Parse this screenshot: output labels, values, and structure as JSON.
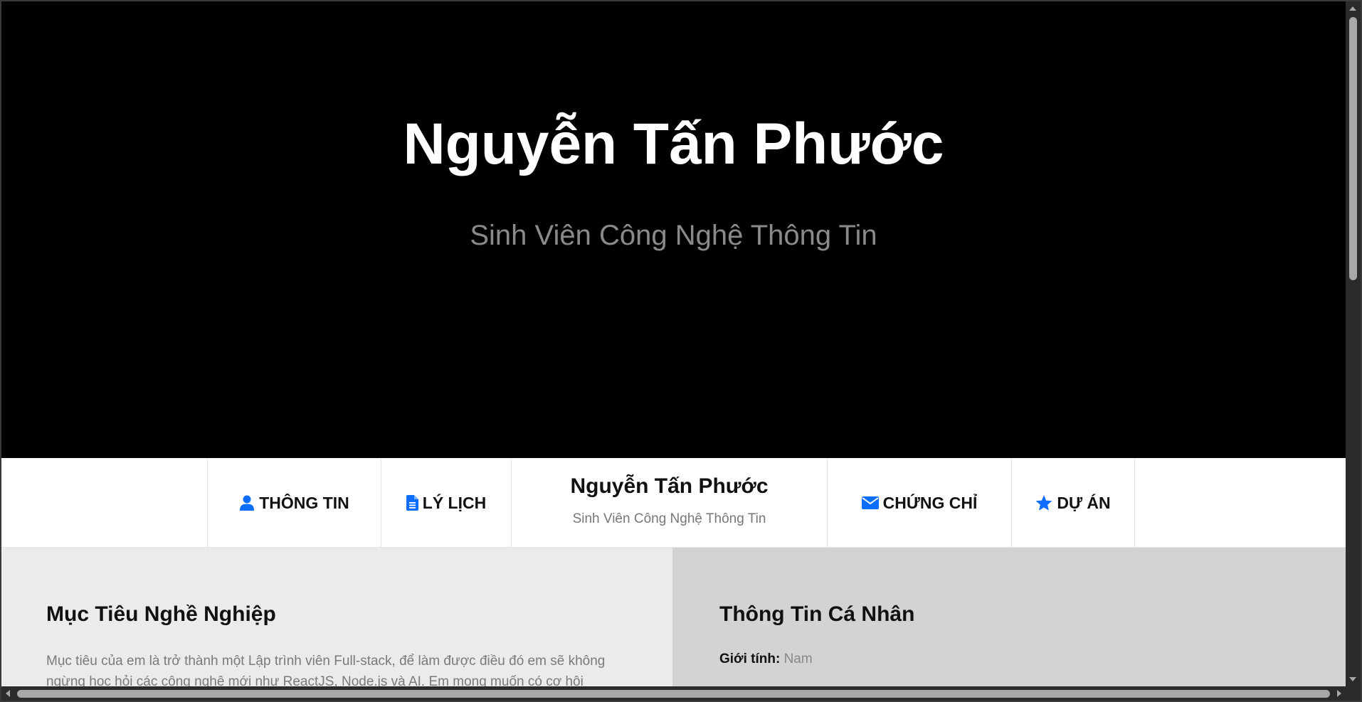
{
  "hero": {
    "title": "Nguyễn Tấn Phước",
    "subtitle": "Sinh Viên Công Nghệ Thông Tin"
  },
  "nav": {
    "items": [
      {
        "label": "THÔNG TIN",
        "icon": "user-icon"
      },
      {
        "label": "LÝ LỊCH",
        "icon": "document-icon"
      },
      {
        "label": "CHỨNG CHỈ",
        "icon": "envelope-icon"
      },
      {
        "label": "DỰ ÁN",
        "icon": "star-icon"
      }
    ],
    "brand": {
      "name": "Nguyễn Tấn Phước",
      "subtitle": "Sinh Viên Công Nghệ Thông Tin"
    }
  },
  "career": {
    "heading": "Mục Tiêu Nghề Nghiệp",
    "text": "Mục tiêu của em là trở thành một Lập trình viên Full-stack, để làm được điều đó em sẽ không ngừng học hỏi các công nghệ mới như ReactJS, Node.js và AI. Em mong muốn có cơ hội"
  },
  "personal": {
    "heading": "Thông Tin Cá Nhân",
    "gender_label": "Giới tính:",
    "gender_value": "Nam"
  },
  "colors": {
    "hero_bg": "#000000",
    "accent_icon": "#0d6efd",
    "left_panel_bg": "#ebebeb",
    "right_panel_bg": "#d3d3d3"
  }
}
